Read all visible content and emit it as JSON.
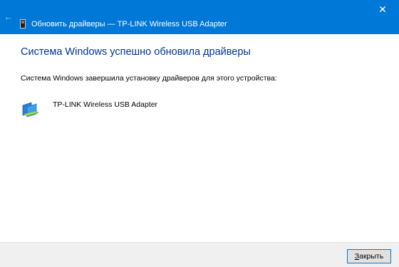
{
  "window": {
    "title": "Обновить драйверы — TP-LINK Wireless USB Adapter",
    "back_glyph": "←",
    "close_glyph": "✕"
  },
  "content": {
    "heading": "Система Windows успешно обновила драйверы",
    "description": "Система Windows завершила установку драйверов для этого устройства:",
    "device_name": "TP-LINK Wireless USB Adapter",
    "device_icon": "network-adapter-icon"
  },
  "footer": {
    "close_label_accel": "З",
    "close_label_rest": "акрыть"
  },
  "colors": {
    "titlebar": "#0078d7",
    "heading": "#003399",
    "footer": "#f0f0f0"
  }
}
